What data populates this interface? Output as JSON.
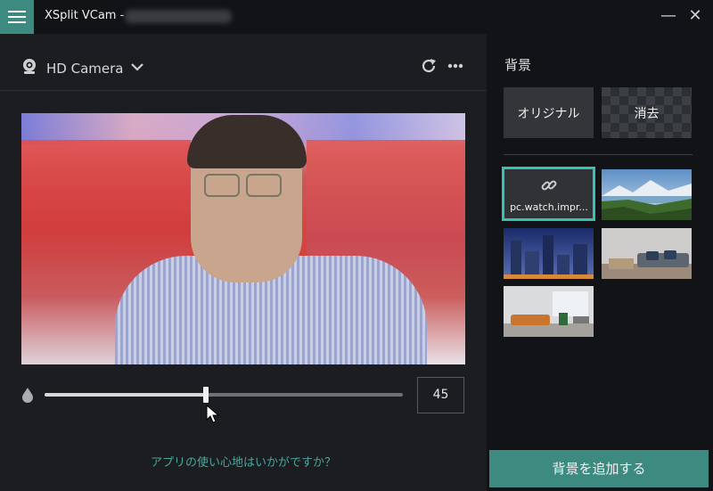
{
  "titlebar": {
    "app_title": "XSplit VCam -",
    "minimize_symbol": "—",
    "close_symbol": "✕"
  },
  "camera": {
    "name": "HD Camera",
    "icons": [
      "webcam-icon",
      "chevron-down-icon",
      "refresh-icon",
      "more-icon"
    ]
  },
  "blur": {
    "value": "45",
    "level_fraction": 0.45
  },
  "feedback_link": "アプリの使い心地はいかがですか？",
  "background_panel": {
    "heading": "背景",
    "original_label": "オリジナル",
    "remove_label": "消去",
    "link_tile_label": "pc.watch.impr...",
    "images": [
      "mountain-lake",
      "city-night",
      "living-room-sofa",
      "living-room-bright"
    ],
    "add_button_label": "背景を追加する"
  },
  "colors": {
    "accent": "#3d8a80",
    "selection": "#36c3b3",
    "link_text": "#4aa79a"
  }
}
